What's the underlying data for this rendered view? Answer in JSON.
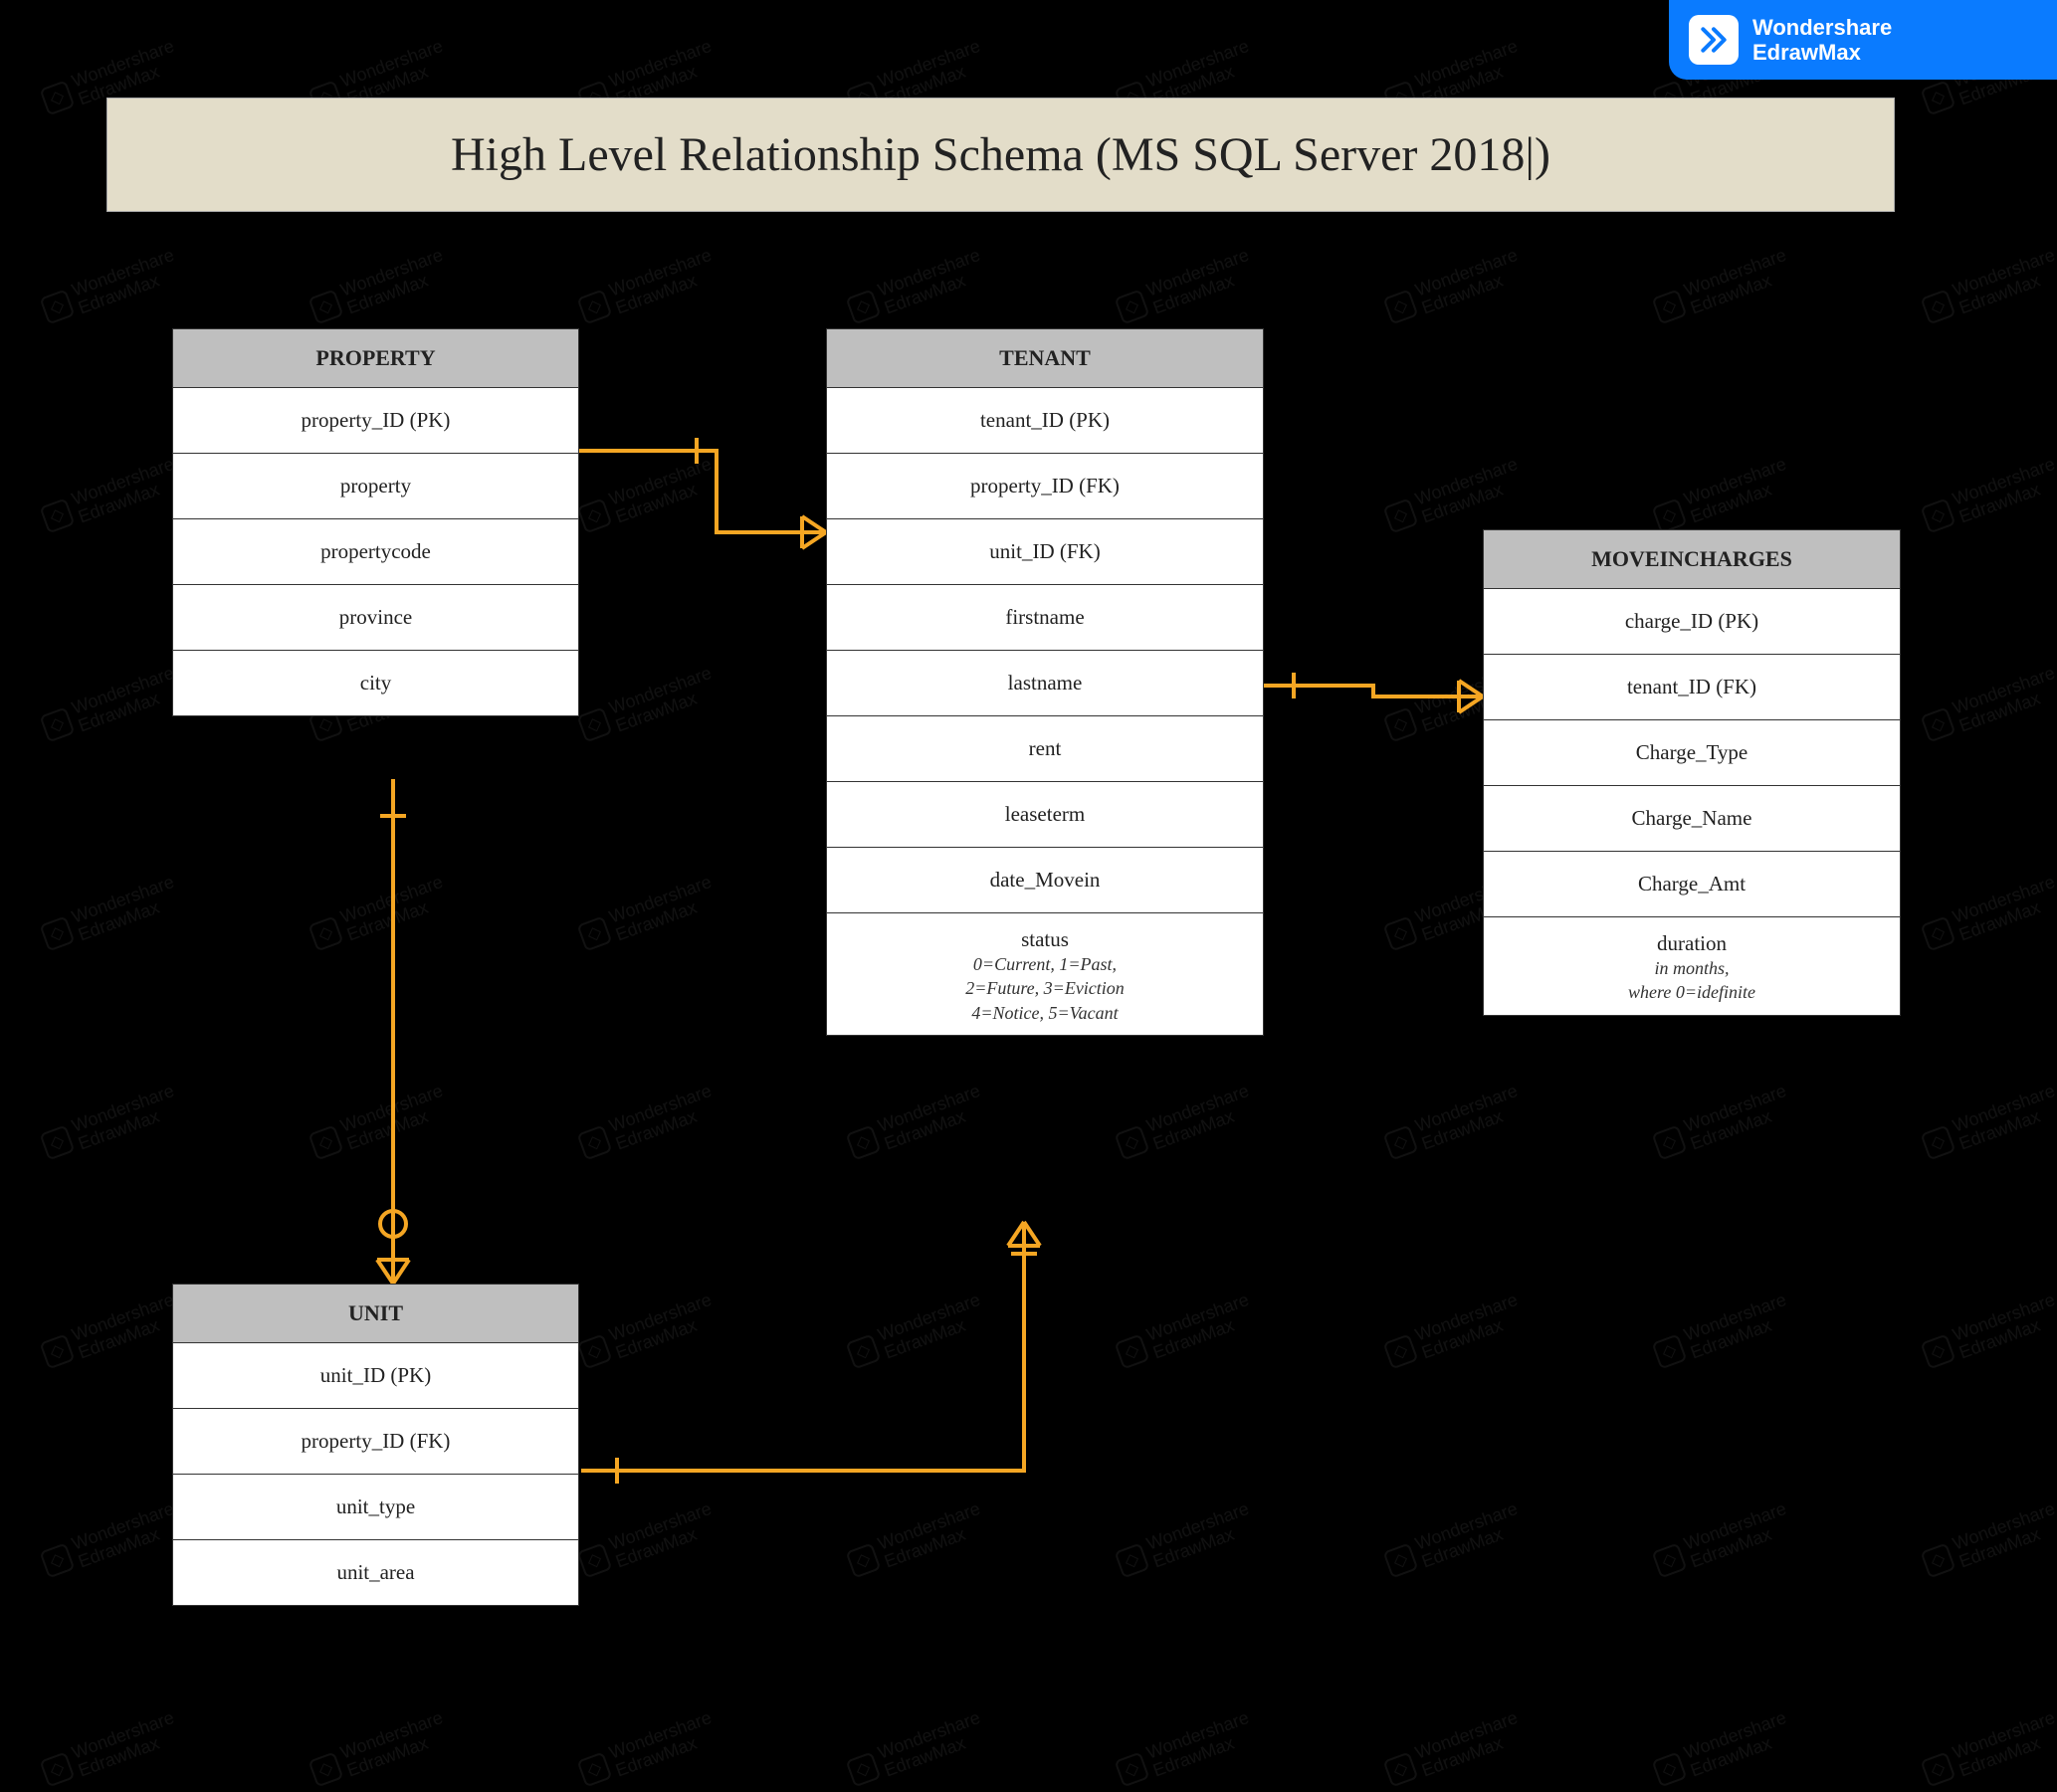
{
  "title": "High Level Relationship Schema (MS SQL Server 2018|)",
  "brand": {
    "line1": "Wondershare",
    "line2": "EdrawMax"
  },
  "watermark": {
    "line1": "Wondershare",
    "line2": "EdrawMax"
  },
  "entities": {
    "property": {
      "name": "PROPERTY",
      "fields": [
        "property_ID (PK)",
        "property",
        "propertycode",
        "province",
        "city"
      ]
    },
    "tenant": {
      "name": "TENANT",
      "fields": [
        "tenant_ID (PK)",
        "property_ID (FK)",
        "unit_ID (FK)",
        "firstname",
        "lastname",
        "rent",
        "leaseterm",
        "date_Movein"
      ],
      "status_label": "status",
      "status_sub1": "0=Current, 1=Past,",
      "status_sub2": "2=Future, 3=Eviction",
      "status_sub3": "4=Notice, 5=Vacant"
    },
    "moveincharges": {
      "name": "MOVEINCHARGES",
      "fields": [
        "charge_ID (PK)",
        "tenant_ID (FK)",
        "Charge_Type",
        "Charge_Name",
        "Charge_Amt"
      ],
      "duration_label": "duration",
      "duration_sub1": "in months,",
      "duration_sub2": "where 0=idefinite"
    },
    "unit": {
      "name": "UNIT",
      "fields": [
        "unit_ID (PK)",
        "property_ID (FK)",
        "unit_type",
        "unit_area"
      ]
    }
  },
  "relationships": [
    {
      "from": "PROPERTY",
      "to": "TENANT",
      "type": "one-to-many"
    },
    {
      "from": "PROPERTY",
      "to": "UNIT",
      "type": "one-to-many-optional"
    },
    {
      "from": "TENANT",
      "to": "MOVEINCHARGES",
      "type": "one-to-many"
    },
    {
      "from": "UNIT",
      "to": "TENANT",
      "type": "one-to-many"
    }
  ]
}
